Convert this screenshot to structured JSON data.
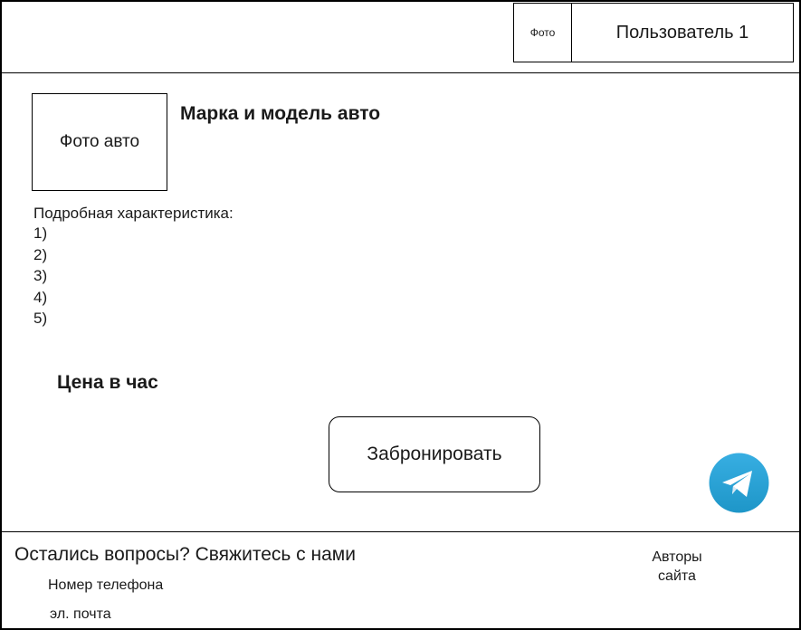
{
  "header": {
    "user_photo_label": "Фото",
    "user_name": "Пользователь 1"
  },
  "car": {
    "photo_label": "Фото авто",
    "title": "Марка и модель авто",
    "specs_title": "Подробная характеристика:",
    "specs": [
      "1)",
      "2)",
      "3)",
      "4)",
      "5)"
    ],
    "price_label": "Цена в час",
    "book_button": "Забронировать"
  },
  "contact": {
    "icon": "telegram-icon",
    "accent_color": "#2AA3DF"
  },
  "footer": {
    "title": "Остались вопросы? Свяжитесь с нами",
    "phone_label": "Номер телефона",
    "email_label": "эл. почта",
    "authors_line1": "Авторы",
    "authors_line2": "сайта"
  }
}
